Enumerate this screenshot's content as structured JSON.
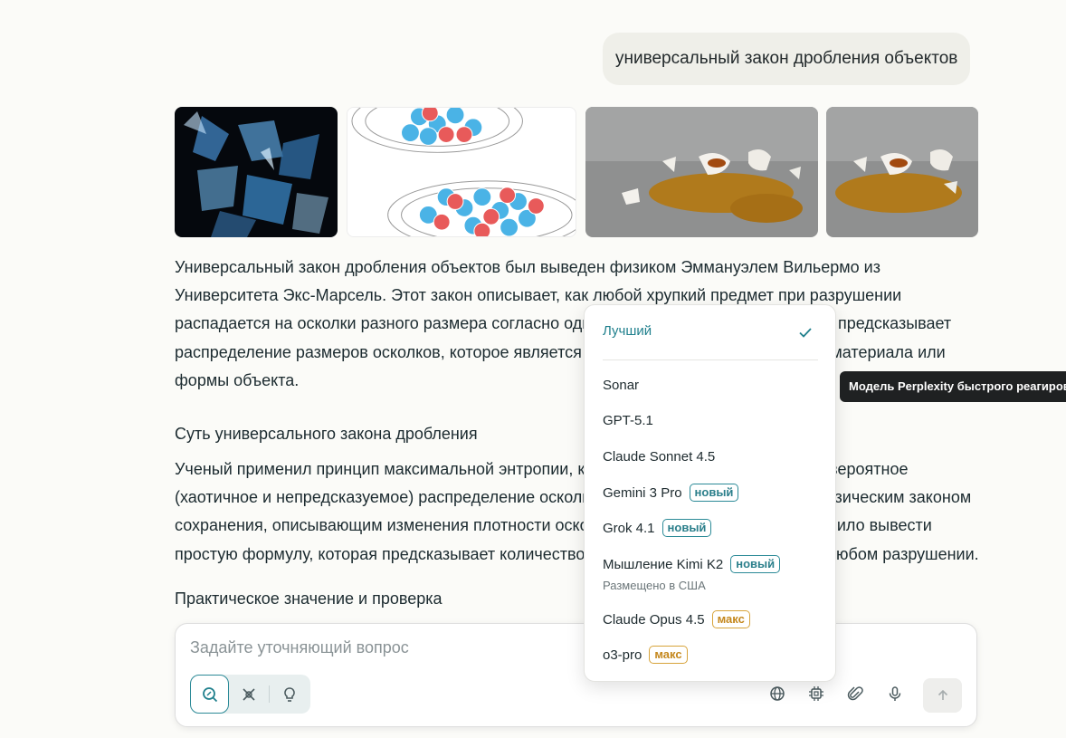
{
  "query": "универсальный закон дробления объектов",
  "images": [
    {
      "name": "shattered-glass-image"
    },
    {
      "name": "particle-fragmentation-diagram"
    },
    {
      "name": "broken-cup-image-1"
    },
    {
      "name": "broken-cup-image-2"
    }
  ],
  "answer": {
    "paragraph1": "Универсальный закон дробления объектов был выведен физиком Эммануэлем Вильермо из Университета Экс-Марсель. Этот закон описывает, как любой хрупкий предмет при разрушении распадается на осколки разного размера согласно одному универсальному закону. Он предсказывает распределение размеров осколков, которое является универсальным и не зависит от материала или формы объекта.",
    "heading1": "Суть универсального закона дробления",
    "paragraph2": "Ученый применил принцип максимальной энтропии, который предполагает наиболее вероятное (хаотичное и непредсказуемое) распределение осколков, и объединил его с новым физическим законом сохранения, описывающим изменения плотности осколков в пространстве. Это позволило вывести простую формулу, которая предсказывает количество осколков каждого размера при любом разрушении.",
    "heading2": "Практическое значение и проверка"
  },
  "composer": {
    "placeholder": "Задайте уточняющий вопрос"
  },
  "model_menu": {
    "best": "Лучший",
    "items": [
      {
        "label": "Sonar",
        "badge": ""
      },
      {
        "label": "GPT-5.1",
        "badge": ""
      },
      {
        "label": "Claude Sonnet 4.5",
        "badge": ""
      },
      {
        "label": "Gemini 3 Pro",
        "badge": "новый"
      },
      {
        "label": "Grok 4.1",
        "badge": "новый"
      },
      {
        "label": "Мышление Kimi K2",
        "badge": "новый",
        "sub": "Размещено в США"
      },
      {
        "label": "Claude Opus 4.5",
        "badge": "макс"
      },
      {
        "label": "o3-pro",
        "badge": "макс"
      }
    ]
  },
  "tooltip": "Модель Perplexity быстрого реагирования",
  "colors": {
    "accent": "#20808d",
    "max_badge": "#d7a33a",
    "background": "#fbfbf8"
  },
  "icons": [
    "search-icon",
    "research-icon",
    "lightbulb-icon",
    "globe-icon",
    "chip-icon",
    "paperclip-icon",
    "microphone-icon",
    "arrow-up-icon",
    "check-icon"
  ]
}
